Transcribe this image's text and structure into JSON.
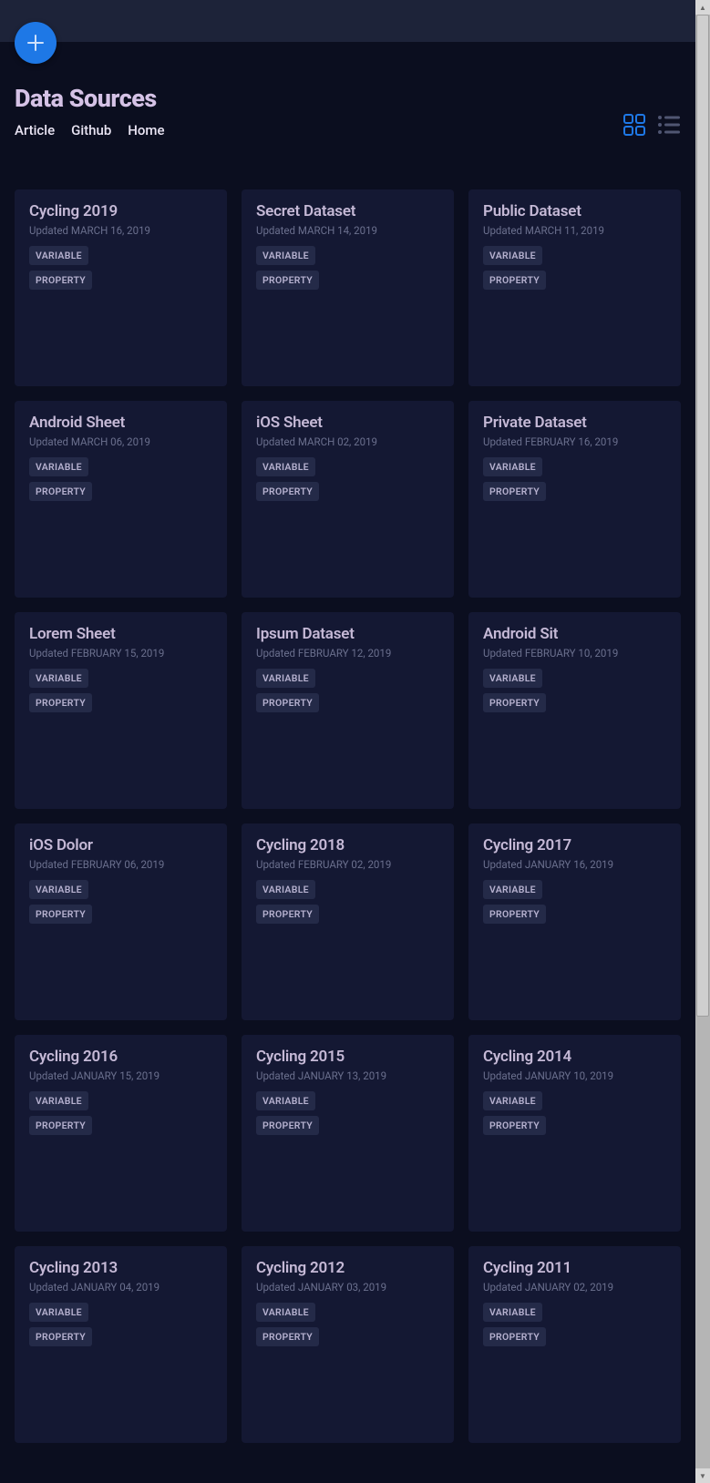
{
  "topbar": {},
  "fab": {
    "icon": "plus-icon"
  },
  "header": {
    "title": "Data Sources",
    "nav": [
      {
        "label": "Article"
      },
      {
        "label": "Github"
      },
      {
        "label": "Home"
      }
    ],
    "view": {
      "grid_active": true
    }
  },
  "tag_labels": {
    "variable": "VARIABLE",
    "property": "PROPERTY"
  },
  "cards": [
    {
      "title": "Cycling 2019",
      "updated": "Updated MARCH 16, 2019",
      "tags": [
        "variable",
        "property"
      ]
    },
    {
      "title": "Secret Dataset",
      "updated": "Updated MARCH 14, 2019",
      "tags": [
        "variable",
        "property"
      ]
    },
    {
      "title": "Public Dataset",
      "updated": "Updated MARCH 11, 2019",
      "tags": [
        "variable",
        "property"
      ]
    },
    {
      "title": "Android Sheet",
      "updated": "Updated MARCH 06, 2019",
      "tags": [
        "variable",
        "property"
      ]
    },
    {
      "title": "iOS Sheet",
      "updated": "Updated MARCH 02, 2019",
      "tags": [
        "variable",
        "property"
      ]
    },
    {
      "title": "Private Dataset",
      "updated": "Updated FEBRUARY 16, 2019",
      "tags": [
        "variable",
        "property"
      ]
    },
    {
      "title": "Lorem Sheet",
      "updated": "Updated FEBRUARY 15, 2019",
      "tags": [
        "variable",
        "property"
      ]
    },
    {
      "title": "Ipsum Dataset",
      "updated": "Updated FEBRUARY 12, 2019",
      "tags": [
        "variable",
        "property"
      ]
    },
    {
      "title": "Android Sit",
      "updated": "Updated FEBRUARY 10, 2019",
      "tags": [
        "variable",
        "property"
      ]
    },
    {
      "title": "iOS Dolor",
      "updated": "Updated FEBRUARY 06, 2019",
      "tags": [
        "variable",
        "property"
      ]
    },
    {
      "title": "Cycling 2018",
      "updated": "Updated FEBRUARY 02, 2019",
      "tags": [
        "variable",
        "property"
      ]
    },
    {
      "title": "Cycling 2017",
      "updated": "Updated JANUARY 16, 2019",
      "tags": [
        "variable",
        "property"
      ]
    },
    {
      "title": "Cycling 2016",
      "updated": "Updated JANUARY 15, 2019",
      "tags": [
        "variable",
        "property"
      ]
    },
    {
      "title": "Cycling 2015",
      "updated": "Updated JANUARY 13, 2019",
      "tags": [
        "variable",
        "property"
      ]
    },
    {
      "title": "Cycling 2014",
      "updated": "Updated JANUARY 10, 2019",
      "tags": [
        "variable",
        "property"
      ]
    },
    {
      "title": "Cycling 2013",
      "updated": "Updated JANUARY 04, 2019",
      "tags": [
        "variable",
        "property"
      ]
    },
    {
      "title": "Cycling 2012",
      "updated": "Updated JANUARY 03, 2019",
      "tags": [
        "variable",
        "property"
      ]
    },
    {
      "title": "Cycling 2011",
      "updated": "Updated JANUARY 02, 2019",
      "tags": [
        "variable",
        "property"
      ]
    }
  ]
}
